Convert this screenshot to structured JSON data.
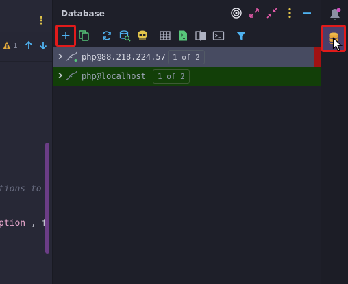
{
  "editor": {
    "warning_count": "1",
    "code_line_1": "tions to ",
    "code_line_2_keyword": "ption",
    "code_line_2_rest": " , f"
  },
  "database_window": {
    "title": "Database",
    "connections": [
      {
        "name": "php@88.218.224.57",
        "badge": "1 of 2",
        "status": "selected, connected"
      },
      {
        "name": "php@localhost",
        "badge": "1 of 2",
        "status": "disconnected"
      }
    ]
  },
  "icons": {
    "header": [
      "target-icon",
      "expand-icon",
      "collapse-icon",
      "options-icon",
      "hide-icon"
    ],
    "toolbar": [
      "add-icon",
      "copy-icon",
      "refresh-icon",
      "schema-search-icon",
      "skull-icon",
      "table-icon",
      "edit-source-icon",
      "compare-icon",
      "console-icon",
      "filter-icon"
    ],
    "right_strip": [
      "notifications-icon",
      "database-icon"
    ]
  },
  "colors": {
    "accent_blue": "#4fb2f0",
    "highlight_red": "#e11b1b",
    "selected_row": "#474b61",
    "localhost_row": "#123f08",
    "warning_yellow": "#e2c54b"
  }
}
